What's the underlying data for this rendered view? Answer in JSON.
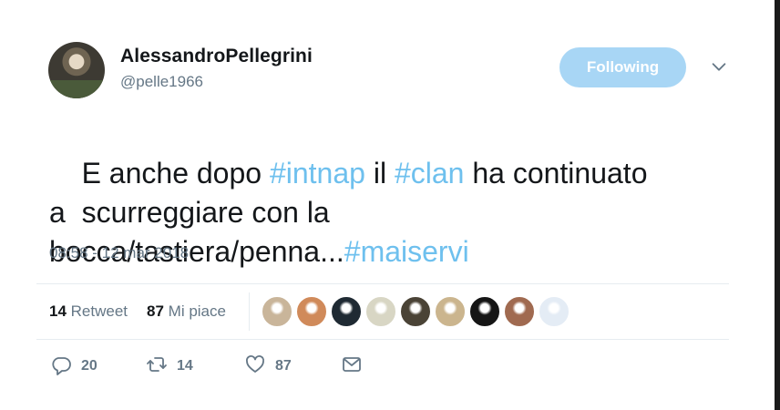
{
  "user": {
    "name": "AlessandroPellegrini",
    "handle": "@pelle1966"
  },
  "follow_button": {
    "label": "Following"
  },
  "tweet": {
    "segments": [
      {
        "text": "E anche dopo ",
        "type": "text"
      },
      {
        "text": "#intnap",
        "type": "hashtag"
      },
      {
        "text": " il ",
        "type": "text"
      },
      {
        "text": "#clan",
        "type": "hashtag"
      },
      {
        "text": " ha continuato\na  scurreggiare con la\nbocca/tastiera/penna...",
        "type": "text"
      },
      {
        "text": "#maiservi",
        "type": "hashtag"
      }
    ],
    "timestamp": "08:58 - 12 mar 2018"
  },
  "stats": {
    "retweets_count": "14",
    "retweets_label": "Retweet",
    "likes_count": "87",
    "likes_label": "Mi piace"
  },
  "likers": [
    {
      "name": "liker-1",
      "color": "#c9b59a"
    },
    {
      "name": "liker-2",
      "color": "#d08a5a"
    },
    {
      "name": "liker-3",
      "color": "#1f2a33"
    },
    {
      "name": "liker-4",
      "color": "#d8d6c4"
    },
    {
      "name": "liker-5",
      "color": "#4a4336"
    },
    {
      "name": "liker-6",
      "color": "#cbb58e"
    },
    {
      "name": "liker-7",
      "color": "#151515"
    },
    {
      "name": "liker-8",
      "color": "#a06a50"
    },
    {
      "name": "liker-9",
      "color": "#e4ecf5"
    }
  ],
  "actions": {
    "replies": "20",
    "retweets": "14",
    "likes": "87"
  },
  "icons": {
    "caret": "chevron-down-icon",
    "reply": "reply-icon",
    "retweet": "retweet-icon",
    "like": "heart-icon",
    "dm": "envelope-icon"
  },
  "colors": {
    "hashtag": "#6ec0ee",
    "follow_button_bg": "#a8d6f5",
    "secondary_text": "#657786"
  }
}
